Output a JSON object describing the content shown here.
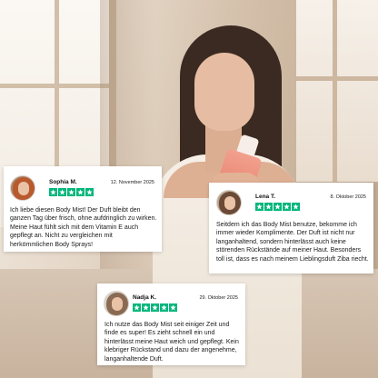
{
  "rating_color": "#00b67a",
  "reviews": [
    {
      "name": "Sophia M.",
      "date": "12. November 2025",
      "stars": 5,
      "text": "Ich liebe diesen Body Mist! Der Duft bleibt den ganzen Tag über frisch, ohne aufdringlich zu wirken. Meine Haut fühlt sich mit dem Vitamin E auch gepflegt an. Nicht zu vergleichen mit herkömmlichen Body Sprays!"
    },
    {
      "name": "Lena T.",
      "date": "8. Oktober 2025",
      "stars": 5,
      "text": "Seitdem ich das Body Mist benutze, bekomme ich immer wieder Komplimente. Der Duft ist nicht nur langanhaltend, sondern hinterlässt auch keine störenden Rückstände auf meiner Haut. Besonders toll ist, dass es nach meinem Lieblingsduft Ziba riecht."
    },
    {
      "name": "Nadja K.",
      "date": "29. Oktober 2025",
      "stars": 5,
      "text": "Ich nutze das Body Mist seit einiger Zeit und finde es super! Es zieht schnell ein und hinterlässt meine Haut weich und gepflegt. Kein klebriger Rückstand und dazu der angenehme, langanhaltende Duft."
    }
  ]
}
